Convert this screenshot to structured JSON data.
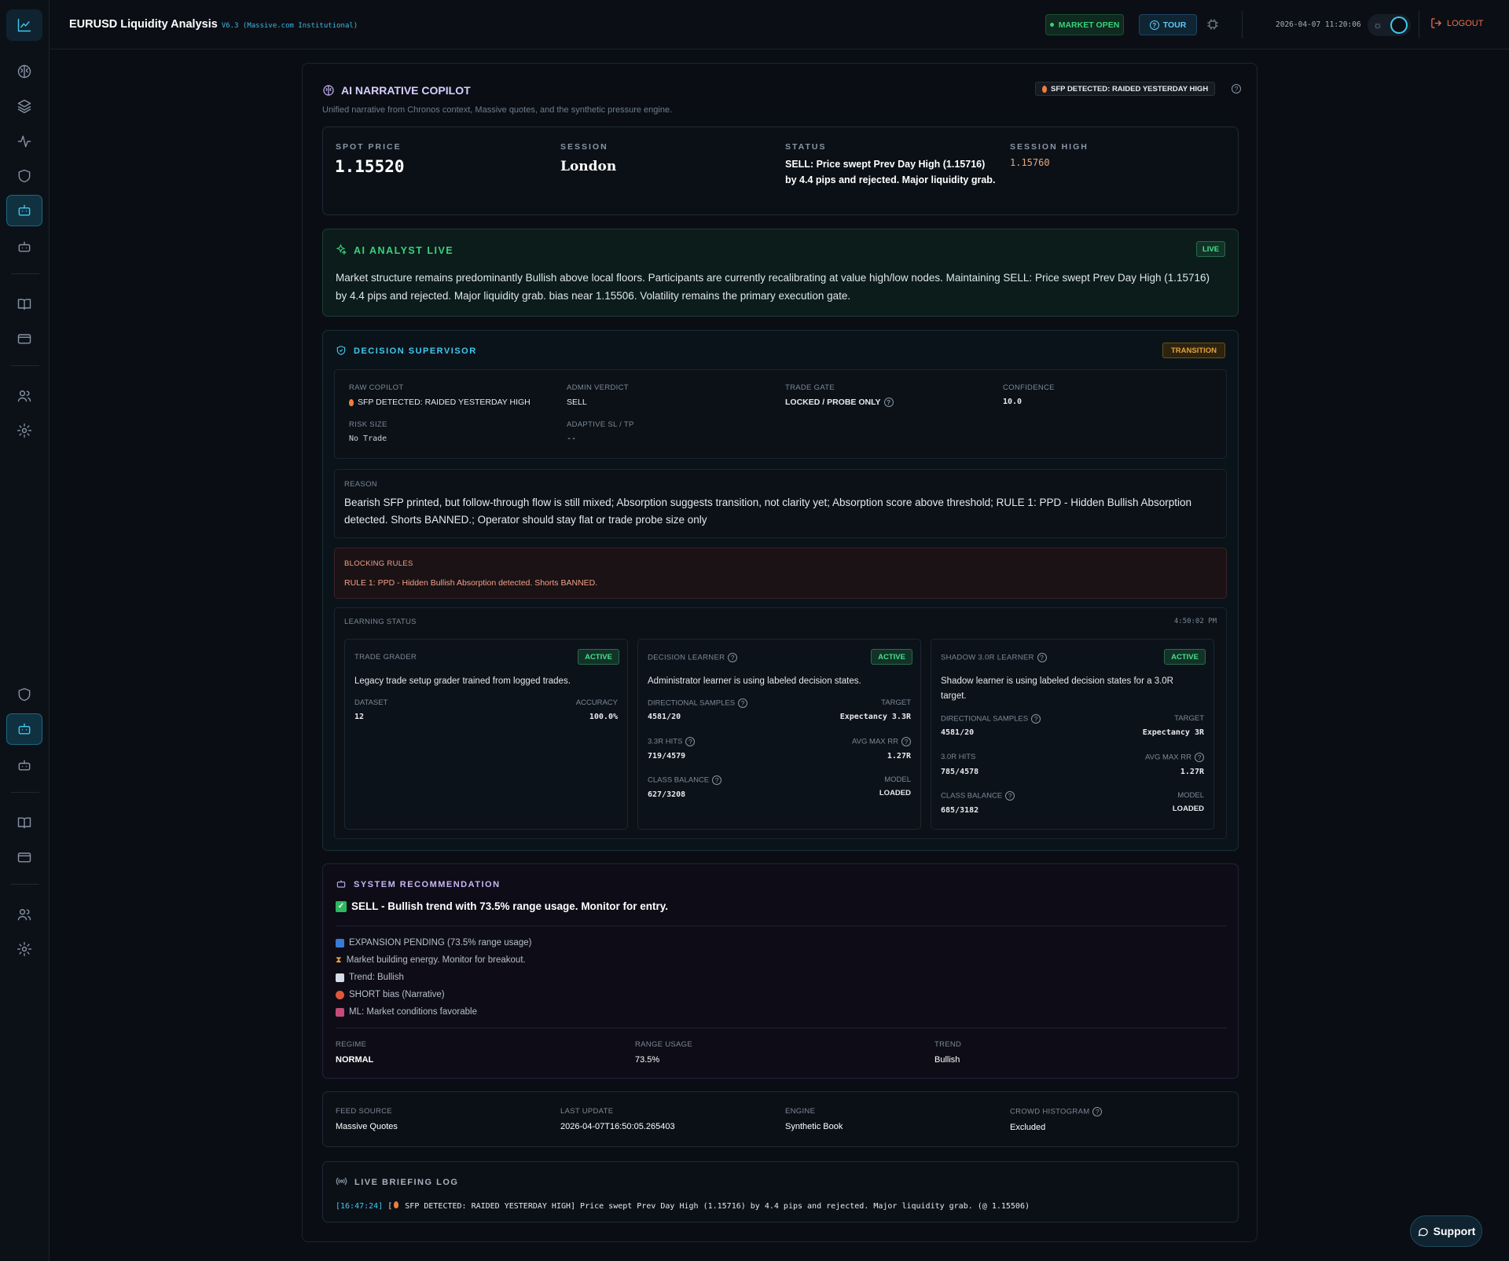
{
  "header": {
    "title": "EURUSD Liquidity Analysis",
    "version": "V6.3 (Massive.com Institutional)",
    "market_status": "MARKET OPEN",
    "tour_label": "TOUR",
    "clock": "2026-04-07 11:20:06",
    "logout_label": "LOGOUT"
  },
  "copilot": {
    "title": "AI NARRATIVE COPILOT",
    "subtitle": "Unified narrative from Chronos context, Massive quotes, and the synthetic pressure engine.",
    "sfp_badge": "SFP DETECTED: RAIDED YESTERDAY HIGH"
  },
  "stats": {
    "spot_label": "SPOT PRICE",
    "spot_value": "1.15520",
    "session_label": "SESSION",
    "session_value": "London",
    "status_label": "STATUS",
    "status_value": "SELL: Price swept Prev Day High (1.15716) by 4.4 pips and rejected. Major liquidity grab.",
    "high_label": "SESSION HIGH",
    "high_value": "1.15760"
  },
  "analyst": {
    "title": "AI ANALYST LIVE",
    "badge": "LIVE",
    "text": "Market structure remains predominantly Bullish above local floors. Participants are currently recalibrating at value high/low nodes. Maintaining SELL: Price swept Prev Day High (1.15716) by 4.4 pips and rejected. Major liquidity grab. bias near 1.15506. Volatility remains the primary execution gate."
  },
  "supervisor": {
    "title": "DECISION SUPERVISOR",
    "badge": "TRANSITION",
    "raw_label": "RAW COPILOT",
    "raw_value": "SFP DETECTED: RAIDED YESTERDAY HIGH",
    "verdict_label": "ADMIN VERDICT",
    "verdict_value": "SELL",
    "gate_label": "TRADE GATE",
    "gate_value": "LOCKED / PROBE ONLY",
    "conf_label": "CONFIDENCE",
    "conf_value": "10.0",
    "risk_label": "RISK SIZE",
    "risk_value": "No Trade",
    "sltp_label": "ADAPTIVE SL / TP",
    "sltp_value": "--",
    "reason_label": "REASON",
    "reason_text": "Bearish SFP printed, but follow-through flow is still mixed; Absorption suggests transition, not clarity yet; Absorption score above threshold; RULE 1: PPD - Hidden Bullish Absorption detected. Shorts BANNED.; Operator should stay flat or trade probe size only",
    "blocking_label": "BLOCKING RULES",
    "blocking_text": "RULE 1: PPD - Hidden Bullish Absorption detected. Shorts BANNED."
  },
  "learning": {
    "label": "LEARNING STATUS",
    "time": "4:50:02 PM",
    "grader": {
      "title": "TRADE GRADER",
      "badge": "ACTIVE",
      "desc": "Legacy trade setup grader trained from logged trades.",
      "dataset_label": "DATASET",
      "dataset_value": "12",
      "acc_label": "ACCURACY",
      "acc_value": "100.0%"
    },
    "decision": {
      "title": "DECISION LEARNER",
      "badge": "ACTIVE",
      "desc": "Administrator learner is using labeled decision states.",
      "ds_label": "DIRECTIONAL SAMPLES",
      "ds_value": "4581/20",
      "target_label": "TARGET",
      "target_value": "Expectancy 3.3R",
      "hits_label": "3.3R HITS",
      "hits_value": "719/4579",
      "rr_label": "AVG MAX RR",
      "rr_value": "1.27R",
      "cb_label": "CLASS BALANCE",
      "cb_value": "627/3208",
      "model_label": "MODEL",
      "model_value": "LOADED"
    },
    "shadow": {
      "title": "SHADOW 3.0R LEARNER",
      "badge": "ACTIVE",
      "desc": "Shadow learner is using labeled decision states for a 3.0R target.",
      "ds_label": "DIRECTIONAL SAMPLES",
      "ds_value": "4581/20",
      "target_label": "TARGET",
      "target_value": "Expectancy 3R",
      "hits_label": "3.0R HITS",
      "hits_value": "785/4578",
      "rr_label": "AVG MAX RR",
      "rr_value": "1.27R",
      "cb_label": "CLASS BALANCE",
      "cb_value": "685/3182",
      "model_label": "MODEL",
      "model_value": "LOADED"
    }
  },
  "recommendation": {
    "title": "SYSTEM RECOMMENDATION",
    "headline": "SELL - Bullish trend with 73.5% range usage. Monitor for entry.",
    "items": [
      "EXPANSION PENDING (73.5% range usage)",
      "Market building energy. Monitor for breakout.",
      "Trend: Bullish",
      "SHORT bias (Narrative)",
      "ML: Market conditions favorable"
    ],
    "regime_label": "REGIME",
    "regime_value": "NORMAL",
    "range_label": "RANGE USAGE",
    "range_value": "73.5%",
    "trend_label": "TREND",
    "trend_value": "Bullish"
  },
  "feed": {
    "source_label": "FEED SOURCE",
    "source_value": "Massive Quotes",
    "update_label": "LAST UPDATE",
    "update_value": "2026-04-07T16:50:05.265403",
    "engine_label": "ENGINE",
    "engine_value": "Synthetic Book",
    "crowd_label": "CROWD HISTOGRAM",
    "crowd_value": "Excluded"
  },
  "log": {
    "title": "LIVE BRIEFING LOG",
    "time": "[16:47:24]",
    "entry": " SFP DETECTED: RAIDED YESTERDAY HIGH] Price swept Prev Day High (1.15716) by 4.4 pips and rejected. Major liquidity grab. (@ 1.15506)"
  },
  "support_label": "Support",
  "colors": {
    "accent": "#41c8ee",
    "green": "#39d27f",
    "amber": "#e6a23c",
    "red": "#f06d4a"
  }
}
